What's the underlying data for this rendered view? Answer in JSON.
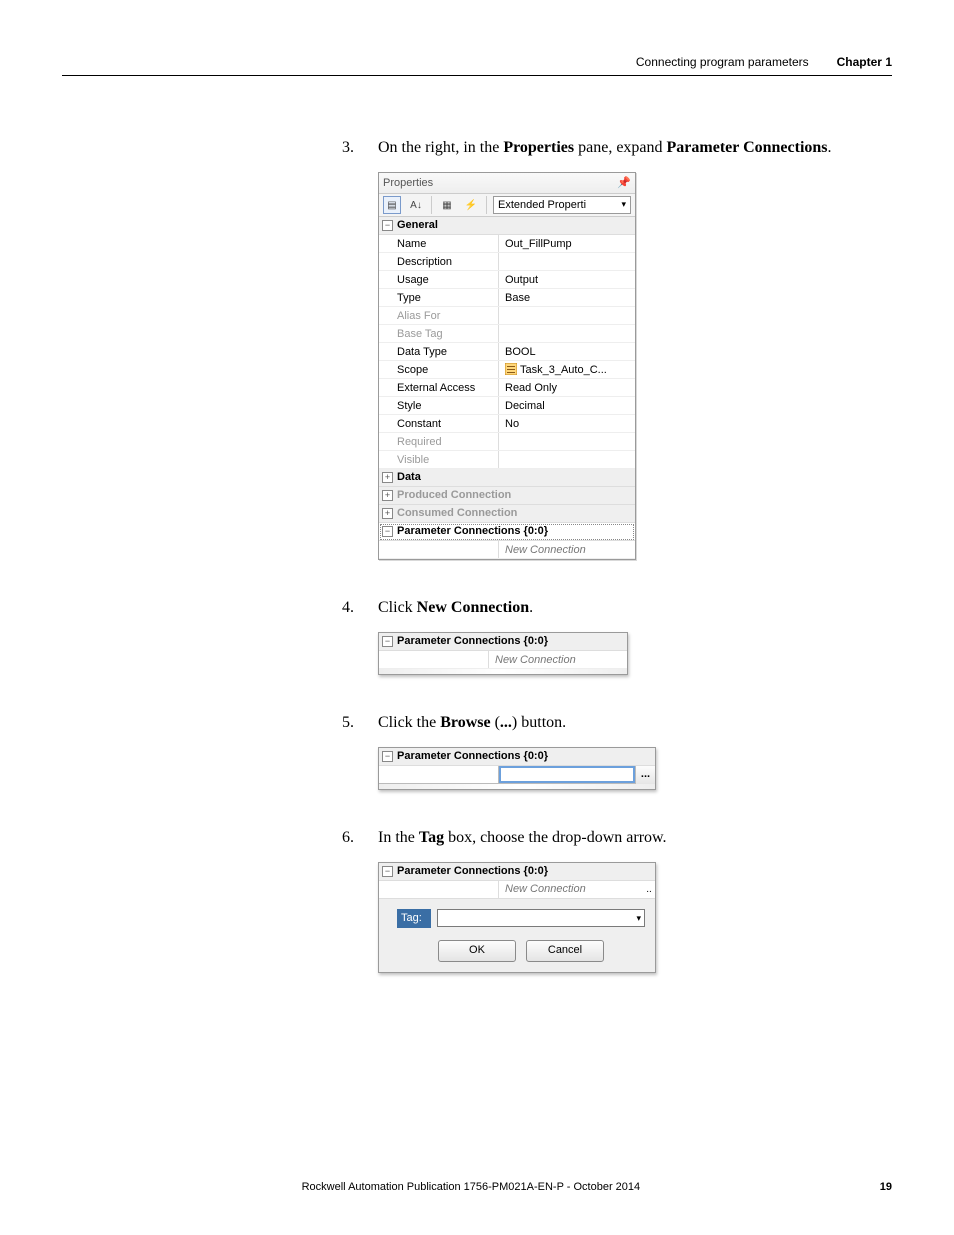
{
  "header": {
    "section": "Connecting program parameters",
    "chapter": "Chapter 1"
  },
  "steps": {
    "s3": {
      "num": "3.",
      "pre": "On the right, in the ",
      "b1": "Properties",
      "mid": " pane, expand ",
      "b2": "Parameter Connections",
      "post": "."
    },
    "s4": {
      "num": "4.",
      "pre": "Click ",
      "b1": "New Connection",
      "post": "."
    },
    "s5": {
      "num": "5.",
      "pre": "Click the ",
      "b1": "Browse",
      "post1": " (",
      "b2": "...",
      "post2": ") button."
    },
    "s6": {
      "num": "6.",
      "pre": "In the ",
      "b1": "Tag",
      "post": " box, choose the drop-down arrow."
    }
  },
  "props": {
    "title": "Properties",
    "toolDrop": "Extended Properti",
    "catGeneral": "General",
    "rows": {
      "name": {
        "k": "Name",
        "v": "Out_FillPump"
      },
      "desc": {
        "k": "Description",
        "v": ""
      },
      "usage": {
        "k": "Usage",
        "v": "Output"
      },
      "type": {
        "k": "Type",
        "v": "Base"
      },
      "alias": {
        "k": "Alias For",
        "v": ""
      },
      "basetag": {
        "k": "Base Tag",
        "v": ""
      },
      "dtype": {
        "k": "Data Type",
        "v": "BOOL"
      },
      "scope": {
        "k": "Scope",
        "v": "Task_3_Auto_C..."
      },
      "ext": {
        "k": "External Access",
        "v": "Read Only"
      },
      "style": {
        "k": "Style",
        "v": "Decimal"
      },
      "const": {
        "k": "Constant",
        "v": "No"
      },
      "req": {
        "k": "Required",
        "v": ""
      },
      "vis": {
        "k": "Visible",
        "v": ""
      }
    },
    "catData": "Data",
    "catProd": "Produced Connection",
    "catCons": "Consumed Connection",
    "catParam": "Parameter Connections {0:0}",
    "newConn": "New Connection"
  },
  "box4": {
    "hdr": "Parameter Connections {0:0}",
    "newConn": "New Connection"
  },
  "box5": {
    "hdr": "Parameter Connections {0:0}",
    "btn": "..."
  },
  "box6": {
    "hdr": "Parameter Connections {0:0}",
    "newConn": "New Connection",
    "dots": "..",
    "tag": "Tag:",
    "ok": "OK",
    "cancel": "Cancel"
  },
  "footer": {
    "pub": "Rockwell Automation Publication 1756-PM021A-EN-P - October 2014",
    "page": "19"
  }
}
